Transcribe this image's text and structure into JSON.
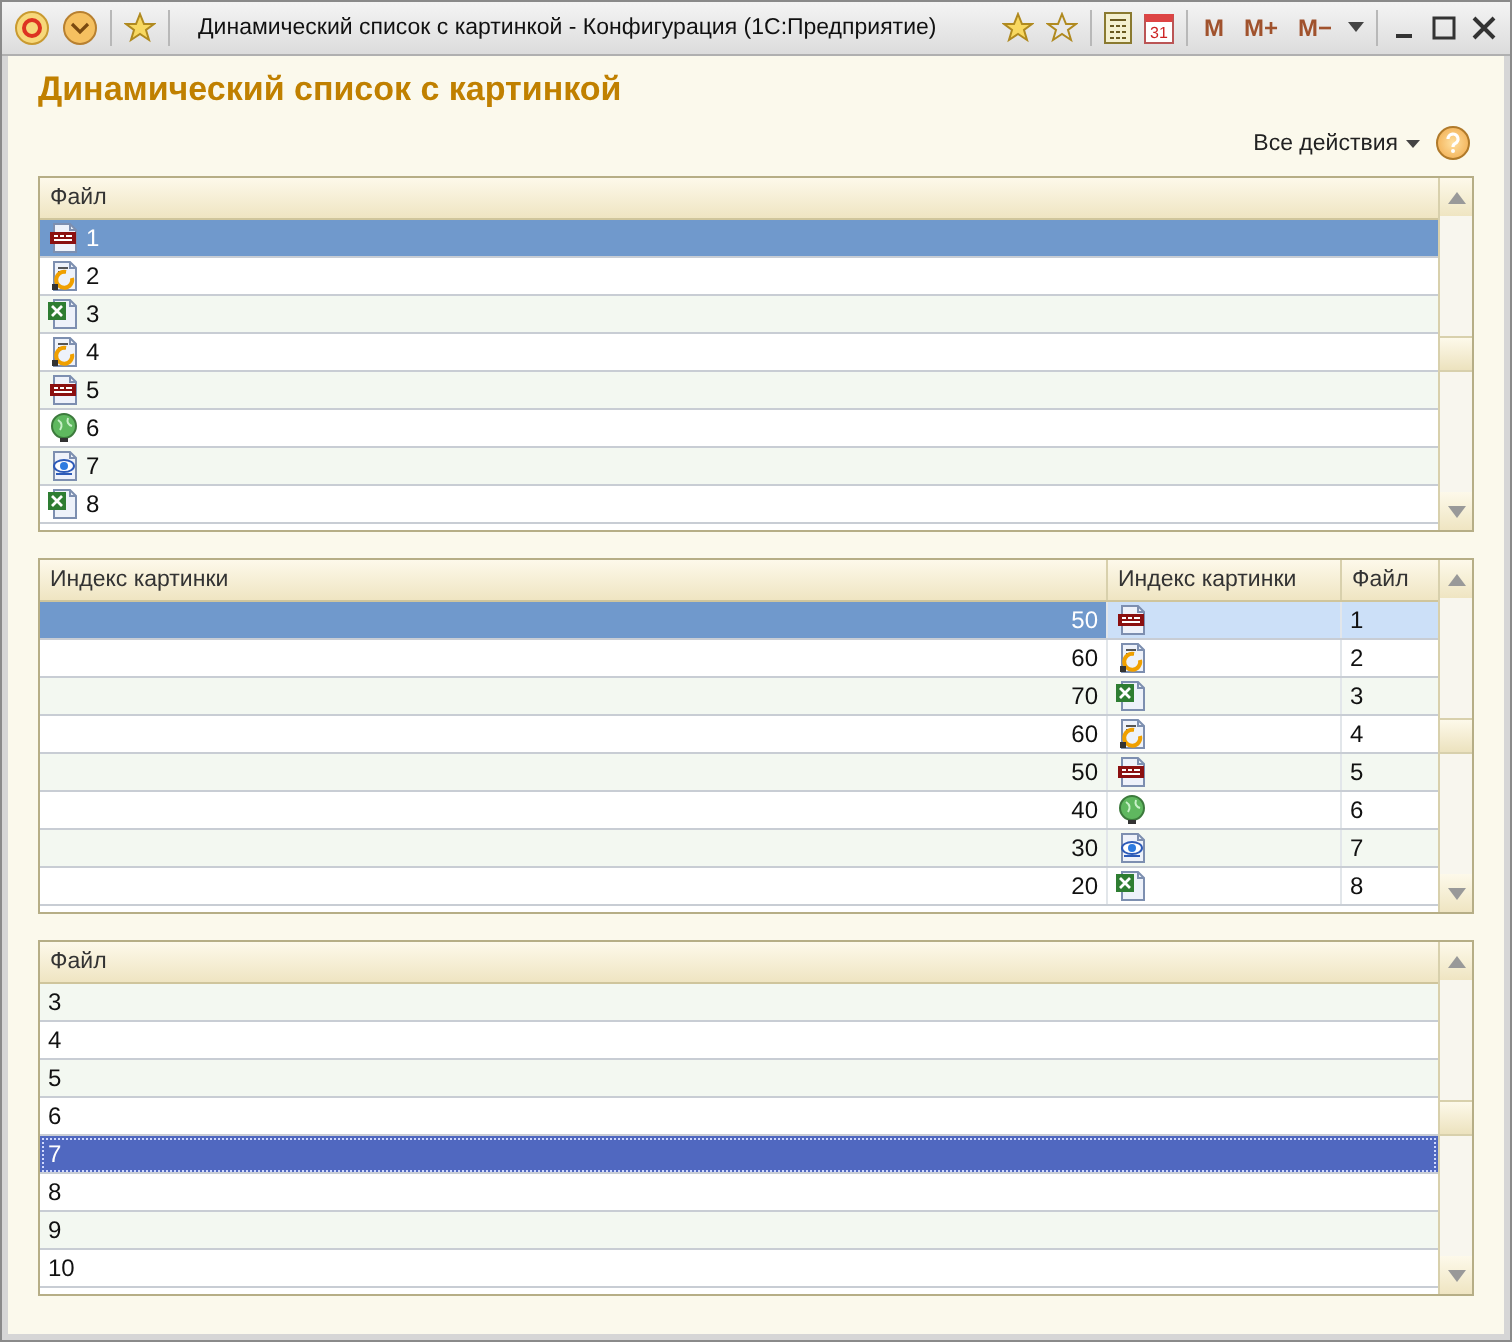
{
  "window": {
    "title": "Динамический список с картинкой - Конфигурация  (1С:Предприятие)",
    "calendar_day": "31",
    "memory_buttons": [
      "M",
      "M+",
      "M−"
    ]
  },
  "heading": "Динамический список с картинкой",
  "actions": {
    "label": "Все действия"
  },
  "table1": {
    "columns": [
      "Файл"
    ],
    "rows": [
      {
        "kind": "png",
        "file": "1",
        "selected": true
      },
      {
        "kind": "onec",
        "file": "2",
        "selected": false
      },
      {
        "kind": "excel",
        "file": "3",
        "selected": false
      },
      {
        "kind": "onec",
        "file": "4",
        "selected": false
      },
      {
        "kind": "png",
        "file": "5",
        "selected": false
      },
      {
        "kind": "globe",
        "file": "6",
        "selected": false
      },
      {
        "kind": "web",
        "file": "7",
        "selected": false
      },
      {
        "kind": "excel",
        "file": "8",
        "selected": false
      }
    ]
  },
  "table2": {
    "columns": [
      "Индекс картинки",
      "Индекс картинки",
      "Файл"
    ],
    "rows": [
      {
        "index": "50",
        "kind": "png",
        "file": "1",
        "selected": true
      },
      {
        "index": "60",
        "kind": "onec",
        "file": "2",
        "selected": false
      },
      {
        "index": "70",
        "kind": "excel",
        "file": "3",
        "selected": false
      },
      {
        "index": "60",
        "kind": "onec",
        "file": "4",
        "selected": false
      },
      {
        "index": "50",
        "kind": "png",
        "file": "5",
        "selected": false
      },
      {
        "index": "40",
        "kind": "globe",
        "file": "6",
        "selected": false
      },
      {
        "index": "30",
        "kind": "web",
        "file": "7",
        "selected": false
      },
      {
        "index": "20",
        "kind": "excel",
        "file": "8",
        "selected": false
      }
    ]
  },
  "table3": {
    "columns": [
      "Файл"
    ],
    "rows": [
      {
        "file": "3",
        "selected": false
      },
      {
        "file": "4",
        "selected": false
      },
      {
        "file": "5",
        "selected": false
      },
      {
        "file": "6",
        "selected": false
      },
      {
        "file": "7",
        "selected": true
      },
      {
        "file": "8",
        "selected": false
      },
      {
        "file": "9",
        "selected": false
      },
      {
        "file": "10",
        "selected": false
      }
    ]
  }
}
